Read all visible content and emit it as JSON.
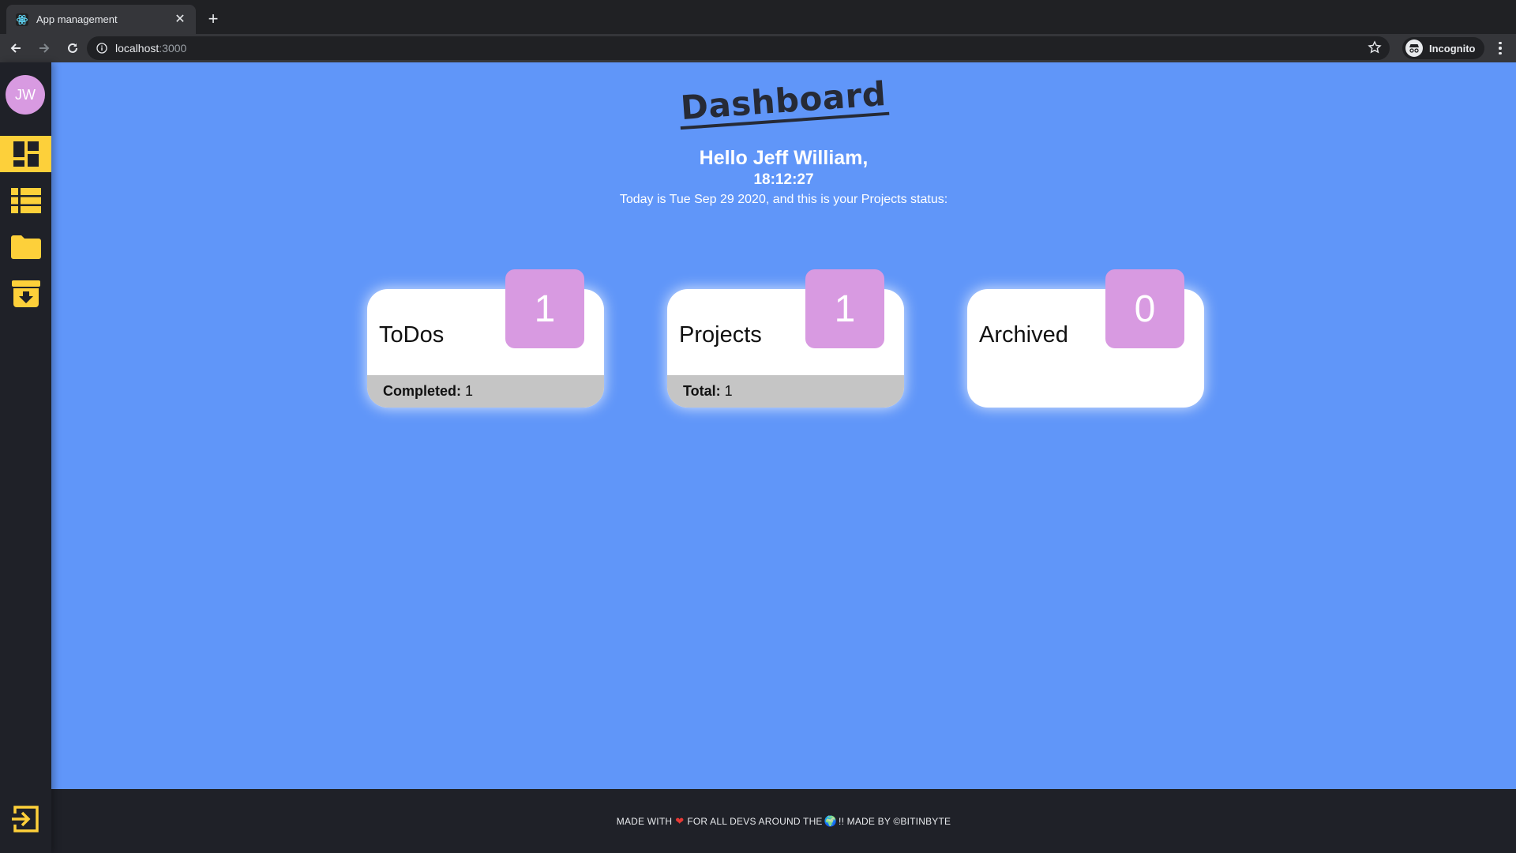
{
  "browser": {
    "tab_title": "App management",
    "url_host": "localhost",
    "url_port": ":3000",
    "incognito_label": "Incognito"
  },
  "sidebar": {
    "avatar_initials": "JW",
    "items": [
      {
        "icon": "dashboard-icon",
        "active": true
      },
      {
        "icon": "list-icon",
        "active": false
      },
      {
        "icon": "folder-icon",
        "active": false
      },
      {
        "icon": "archive-icon",
        "active": false
      }
    ],
    "logout_icon": "logout-icon",
    "accent_color": "#fdd03a"
  },
  "dashboard": {
    "title": "Dashboard",
    "greeting": "Hello Jeff William,",
    "clock": "18:12:27",
    "today": "Today is Tue Sep 29 2020, and this is your Projects status:"
  },
  "cards": [
    {
      "label": "ToDos",
      "count": "1",
      "foot_label": "Completed:",
      "foot_value": "1"
    },
    {
      "label": "Projects",
      "count": "1",
      "foot_label": "Total:",
      "foot_value": "1"
    },
    {
      "label": "Archived",
      "count": "0"
    }
  ],
  "footer": {
    "part1": "MADE WITH",
    "part2": "FOR ALL DEVS AROUND THE",
    "part3": "!! MADE BY ©BITINBYTE"
  },
  "colors": {
    "background": "#6096f9",
    "badge": "#d89ae1",
    "sidebar": "#1f2128"
  }
}
